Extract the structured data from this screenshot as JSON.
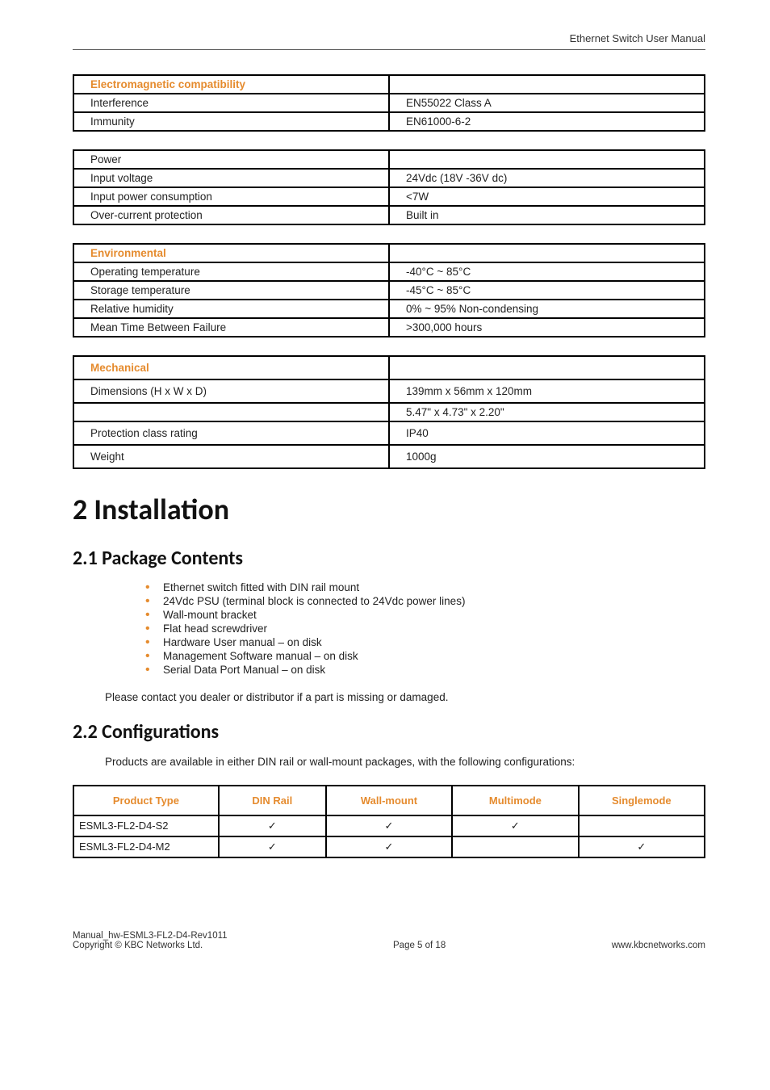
{
  "header": {
    "doc_title": "Ethernet Switch User Manual"
  },
  "tables": {
    "emc": {
      "heading": "Electromagnetic compatibility",
      "rows": [
        {
          "label": "Interference",
          "value": "EN55022 Class A"
        },
        {
          "label": "Immunity",
          "value": "EN61000-6-2"
        }
      ]
    },
    "power": {
      "heading": "Power",
      "rows": [
        {
          "label": "Input voltage",
          "value": "24Vdc (18V -36V dc)"
        },
        {
          "label": "Input power consumption",
          "value": "<7W"
        },
        {
          "label": "Over-current protection",
          "value": "Built in"
        }
      ]
    },
    "env": {
      "heading": "Environmental",
      "rows": [
        {
          "label": "Operating temperature",
          "value": "-40°C ~ 85°C"
        },
        {
          "label": "Storage temperature",
          "value": "-45°C ~ 85°C"
        },
        {
          "label": "Relative humidity",
          "value": "0% ~ 95% Non-condensing"
        },
        {
          "label": "Mean Time Between Failure",
          "value": ">300,000 hours"
        }
      ]
    },
    "mech": {
      "heading": "Mechanical",
      "rows": [
        {
          "label": "Dimensions (H x W x D)",
          "value": "139mm x 56mm x 120mm"
        },
        {
          "label": "",
          "value": "5.47\" x 4.73\" x 2.20\""
        },
        {
          "label": "Protection class rating",
          "value": "IP40"
        },
        {
          "label": "Weight",
          "value": "1000g"
        }
      ]
    }
  },
  "installation": {
    "heading": "2 Installation",
    "package": {
      "heading": "2.1 Package Contents",
      "items": [
        "Ethernet switch fitted with DIN rail mount",
        "24Vdc PSU (terminal block is connected to 24Vdc power lines)",
        "Wall-mount bracket",
        "Flat head screwdriver",
        "Hardware User manual – on disk",
        "Management Software manual – on disk",
        "Serial Data Port Manual – on disk"
      ],
      "note": "Please contact you dealer or distributor if a part is missing or damaged."
    },
    "config": {
      "heading": "2.2  Configurations",
      "intro": "Products are available in either DIN rail or wall-mount packages, with the following configurations:",
      "columns": [
        "Product Type",
        "DIN Rail",
        "Wall-mount",
        "Multimode",
        "Singlemode"
      ],
      "rows": [
        {
          "name": "ESML3-FL2-D4-S2",
          "din": "✓",
          "wall": "✓",
          "mm": "✓",
          "sm": ""
        },
        {
          "name": "ESML3-FL2-D4-M2",
          "din": "✓",
          "wall": "✓",
          "mm": "",
          "sm": "✓"
        }
      ]
    }
  },
  "footer": {
    "line1": "Manual_hw-ESML3-FL2-D4-Rev1011",
    "line2": "Copyright © KBC Networks Ltd.",
    "center": "Page 5 of 18",
    "right": "www.kbcnetworks.com"
  }
}
